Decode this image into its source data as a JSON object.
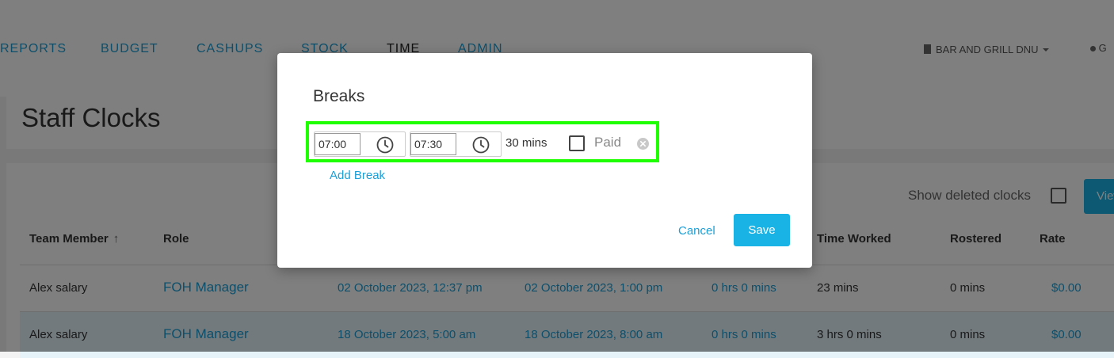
{
  "nav": {
    "items": [
      {
        "label": "REPORTS"
      },
      {
        "label": "BUDGET"
      },
      {
        "label": "CASHUPS"
      },
      {
        "label": "STOCK"
      },
      {
        "label": "TIME"
      },
      {
        "label": "ADMIN"
      }
    ],
    "active": "TIME",
    "venue": "BAR AND GRILL DNU",
    "user_initial": "G"
  },
  "page": {
    "title": "Staff Clocks",
    "show_deleted_label": "Show deleted clocks",
    "show_deleted_checked": false,
    "view_button_label": "View"
  },
  "table": {
    "headers": {
      "team_member": "Team Member",
      "sort_arrow": "↑",
      "role": "Role",
      "time_worked": "Time Worked",
      "rostered": "Rostered",
      "rate": "Rate"
    },
    "rows": [
      {
        "team_member": "Alex salary",
        "role": "FOH Manager",
        "clock_in": "02 October 2023, 12:37 pm",
        "clock_out": "02 October 2023, 1:00 pm",
        "break": "0 hrs 0 mins",
        "time_worked": "23 mins",
        "rostered": "0 mins",
        "rate": "$0.00"
      },
      {
        "team_member": "Alex salary",
        "role": "FOH Manager",
        "clock_in": "18 October 2023, 5:00 am",
        "clock_out": "18 October 2023, 8:00 am",
        "break": "0 hrs 0 mins",
        "time_worked": "3 hrs 0 mins",
        "rostered": "0 mins",
        "rate": "$0.00"
      }
    ]
  },
  "modal": {
    "title": "Breaks",
    "break": {
      "start": "07:00",
      "end": "07:30",
      "duration": "30 mins",
      "paid_label": "Paid",
      "paid_checked": false
    },
    "add_break_label": "Add Break",
    "cancel_label": "Cancel",
    "save_label": "Save"
  },
  "colors": {
    "accent": "#1ab3e6",
    "link": "#1b9fd6",
    "highlight": "#1eff00"
  },
  "icons": {
    "clock": "clock-icon",
    "remove": "remove-circle-icon",
    "venue": "building-icon",
    "user": "user-icon",
    "dropdown": "caret-down-icon"
  }
}
